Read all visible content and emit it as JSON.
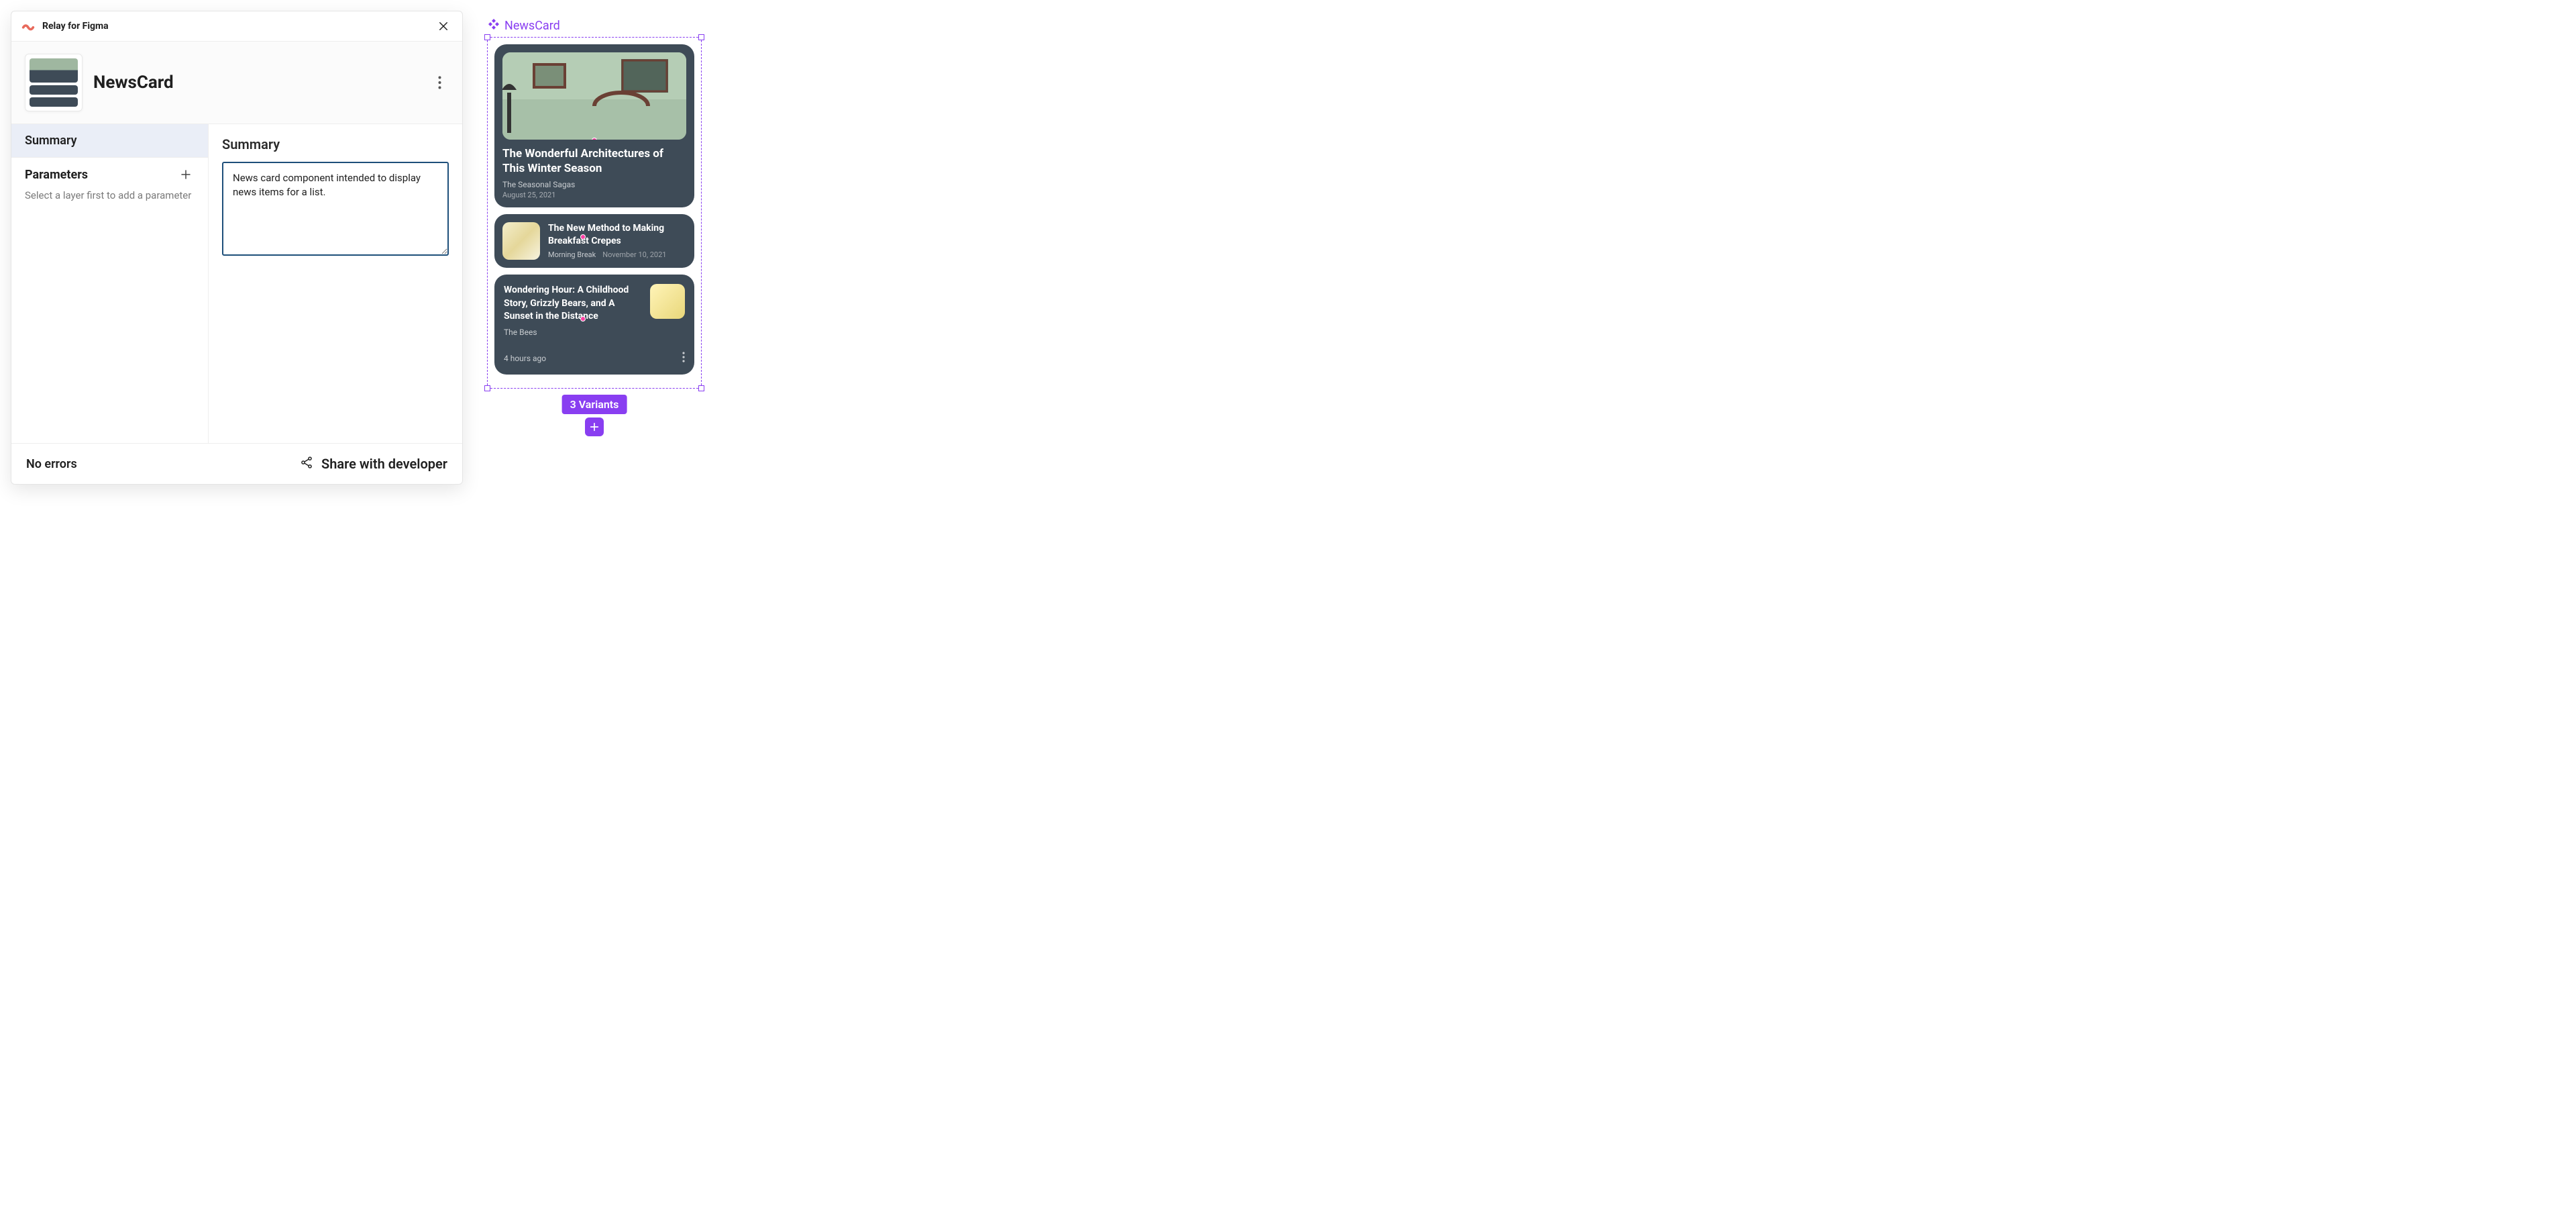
{
  "plugin": {
    "name": "Relay for Figma"
  },
  "component": {
    "name": "NewsCard"
  },
  "sidebar": {
    "tabs": {
      "summary": "Summary",
      "parameters": "Parameters"
    },
    "parametersHint": "Select a layer first to add a parameter"
  },
  "main": {
    "title": "Summary",
    "summaryText": "News card component intended to display news items for a list."
  },
  "footer": {
    "status": "No errors",
    "shareLabel": "Share with developer"
  },
  "canvas": {
    "componentLabel": "NewsCard",
    "variantsLabel": "3 Variants",
    "cards": [
      {
        "title": "The Wonderful Architectures of This Winter Season",
        "source": "The Seasonal Sagas",
        "date": "August 25, 2021"
      },
      {
        "title": "The New Method to Making Breakfast Crepes",
        "source": "Morning Break",
        "date": "November 10, 2021"
      },
      {
        "title": "Wondering Hour: A Childhood Story, Grizzly Bears, and A Sunset in the Distance",
        "source": "The Bees",
        "time": "4 hours ago"
      }
    ]
  }
}
